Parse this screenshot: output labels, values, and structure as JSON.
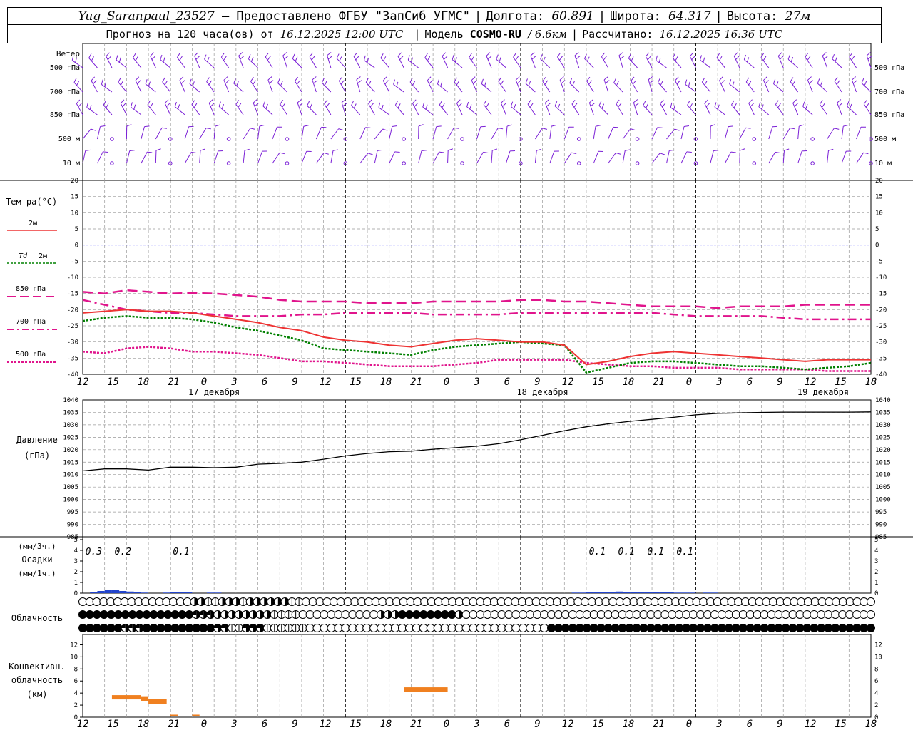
{
  "header": {
    "station": "Yug_Saranpaul_23527",
    "provider": "— Предоставлено ФГБУ \"ЗапСиб УГМС\"",
    "lon_label": "Долгота:",
    "lon_value": "60.891",
    "lat_label": "Широта:",
    "lat_value": "64.317",
    "alt_label": "Высота:",
    "alt_value": "27м",
    "forecast_label": "Прогноз на 120 часа(ов) от",
    "forecast_start": "16.12.2025 12:00 UTC",
    "model_label": "Модель",
    "model_name": "COSMO-RU",
    "model_res": "/ 6.6км",
    "calc_label": "Рассчитано:",
    "calc_time": "16.12.2025 16:36 UTC"
  },
  "labels": {
    "wind": "Ветер",
    "wind_levels": [
      "500 гПа",
      "700 гПа",
      "850 гПа",
      "500 м",
      "10 м"
    ],
    "temp_title": "Тем-ра(°C)",
    "temp_2m": "2м",
    "td_prefix": "Td",
    "td_2m": "2м",
    "t850": "850 гПа",
    "t700": "700 гПа",
    "t500": "500 гПа",
    "pressure": "Давление",
    "pressure_unit": "(гПа)",
    "precip_3h": "(мм/3ч.)",
    "precip": "Осадки",
    "precip_1h": "(мм/1ч.)",
    "cloud": "Облачность",
    "conv1": "Конвективн.",
    "conv2": "облачность",
    "conv3": "(км)"
  },
  "colors": {
    "wind": "#7a1fd6",
    "t2m": "#ee3333",
    "td2m": "#008000",
    "t850": "#e0148c",
    "t700": "#e0148c",
    "t500": "#e0148c",
    "zero_line": "#3a3aff",
    "pressure": "#000000",
    "precip": "#2244cc",
    "conv": "#f08020"
  },
  "chart_data": {
    "type": "line",
    "x_start": "16.12.2025 12:00 UTC",
    "x_step_hours": 1,
    "x_tick_labels": [
      "12",
      "15",
      "18",
      "21",
      "0",
      "3",
      "6",
      "9",
      "12",
      "15",
      "18",
      "21",
      "0",
      "3",
      "6",
      "9",
      "12",
      "15",
      "18",
      "21",
      "0",
      "3",
      "6",
      "9",
      "12",
      "15",
      "18"
    ],
    "day_labels": [
      "17 декабря",
      "18 декабря",
      "19 декабря"
    ],
    "temperature": {
      "ylim": [
        -40,
        20
      ],
      "yticks": [
        20,
        15,
        10,
        5,
        0,
        -5,
        -10,
        -15,
        -20,
        -25,
        -30,
        -35,
        -40
      ],
      "series": {
        "t2m": [
          [
            0,
            -21.0
          ],
          [
            3,
            -20.5
          ],
          [
            6,
            -20.0
          ],
          [
            9,
            -20.5
          ],
          [
            12,
            -20.5
          ],
          [
            15,
            -21.0
          ],
          [
            18,
            -22.0
          ],
          [
            21,
            -23.0
          ],
          [
            24,
            -24.0
          ],
          [
            27,
            -25.5
          ],
          [
            30,
            -26.5
          ],
          [
            33,
            -28.5
          ],
          [
            36,
            -29.5
          ],
          [
            39,
            -30.0
          ],
          [
            42,
            -31.0
          ],
          [
            45,
            -31.5
          ],
          [
            48,
            -30.5
          ],
          [
            51,
            -29.5
          ],
          [
            54,
            -29.0
          ],
          [
            57,
            -29.5
          ],
          [
            60,
            -30.0
          ],
          [
            63,
            -30.0
          ],
          [
            66,
            -31.0
          ],
          [
            69,
            -37.0
          ],
          [
            72,
            -36.0
          ],
          [
            75,
            -34.5
          ],
          [
            78,
            -33.5
          ],
          [
            81,
            -33.0
          ],
          [
            84,
            -33.5
          ],
          [
            87,
            -34.0
          ],
          [
            90,
            -34.5
          ],
          [
            93,
            -35.0
          ],
          [
            96,
            -35.5
          ],
          [
            99,
            -36.0
          ],
          [
            102,
            -35.5
          ],
          [
            105,
            -35.5
          ],
          [
            108,
            -35.5
          ]
        ],
        "td2m": [
          [
            0,
            -23.5
          ],
          [
            3,
            -22.5
          ],
          [
            6,
            -22.0
          ],
          [
            9,
            -22.5
          ],
          [
            12,
            -22.5
          ],
          [
            15,
            -23.0
          ],
          [
            18,
            -24.0
          ],
          [
            21,
            -25.5
          ],
          [
            24,
            -26.5
          ],
          [
            27,
            -28.0
          ],
          [
            30,
            -29.5
          ],
          [
            33,
            -32.0
          ],
          [
            36,
            -32.5
          ],
          [
            39,
            -33.0
          ],
          [
            42,
            -33.5
          ],
          [
            45,
            -34.0
          ],
          [
            48,
            -32.5
          ],
          [
            51,
            -31.5
          ],
          [
            54,
            -31.0
          ],
          [
            57,
            -30.5
          ],
          [
            60,
            -30.0
          ],
          [
            63,
            -30.5
          ],
          [
            66,
            -31.0
          ],
          [
            69,
            -39.5
          ],
          [
            72,
            -38.0
          ],
          [
            75,
            -36.5
          ],
          [
            78,
            -36.0
          ],
          [
            81,
            -36.0
          ],
          [
            84,
            -36.5
          ],
          [
            87,
            -37.0
          ],
          [
            90,
            -37.5
          ],
          [
            93,
            -37.5
          ],
          [
            96,
            -38.0
          ],
          [
            99,
            -38.5
          ],
          [
            102,
            -38.0
          ],
          [
            105,
            -37.5
          ],
          [
            108,
            -36.5
          ]
        ],
        "t850": [
          [
            0,
            -14.5
          ],
          [
            3,
            -15.0
          ],
          [
            6,
            -14.0
          ],
          [
            9,
            -14.5
          ],
          [
            12,
            -15.0
          ],
          [
            15,
            -14.8
          ],
          [
            18,
            -15.0
          ],
          [
            21,
            -15.5
          ],
          [
            24,
            -16.0
          ],
          [
            27,
            -17.0
          ],
          [
            30,
            -17.5
          ],
          [
            33,
            -17.5
          ],
          [
            36,
            -17.5
          ],
          [
            39,
            -18.0
          ],
          [
            42,
            -18.0
          ],
          [
            45,
            -18.0
          ],
          [
            48,
            -17.5
          ],
          [
            51,
            -17.5
          ],
          [
            54,
            -17.5
          ],
          [
            57,
            -17.5
          ],
          [
            60,
            -17.0
          ],
          [
            63,
            -17.0
          ],
          [
            66,
            -17.5
          ],
          [
            69,
            -17.5
          ],
          [
            72,
            -18.0
          ],
          [
            75,
            -18.5
          ],
          [
            78,
            -19.0
          ],
          [
            81,
            -19.0
          ],
          [
            84,
            -19.0
          ],
          [
            87,
            -19.5
          ],
          [
            90,
            -19.0
          ],
          [
            93,
            -19.0
          ],
          [
            96,
            -19.0
          ],
          [
            99,
            -18.5
          ],
          [
            102,
            -18.5
          ],
          [
            105,
            -18.5
          ],
          [
            108,
            -18.5
          ]
        ],
        "t700": [
          [
            0,
            -17.0
          ],
          [
            3,
            -18.5
          ],
          [
            6,
            -20.0
          ],
          [
            9,
            -20.5
          ],
          [
            12,
            -21.0
          ],
          [
            15,
            -21.0
          ],
          [
            18,
            -21.5
          ],
          [
            21,
            -22.0
          ],
          [
            24,
            -22.0
          ],
          [
            27,
            -22.0
          ],
          [
            30,
            -21.5
          ],
          [
            33,
            -21.5
          ],
          [
            36,
            -21.0
          ],
          [
            39,
            -21.0
          ],
          [
            42,
            -21.0
          ],
          [
            45,
            -21.0
          ],
          [
            48,
            -21.5
          ],
          [
            51,
            -21.5
          ],
          [
            54,
            -21.5
          ],
          [
            57,
            -21.5
          ],
          [
            60,
            -21.0
          ],
          [
            63,
            -21.0
          ],
          [
            66,
            -21.0
          ],
          [
            69,
            -21.0
          ],
          [
            72,
            -21.0
          ],
          [
            75,
            -21.0
          ],
          [
            78,
            -21.0
          ],
          [
            81,
            -21.5
          ],
          [
            84,
            -22.0
          ],
          [
            87,
            -22.0
          ],
          [
            90,
            -22.0
          ],
          [
            93,
            -22.0
          ],
          [
            96,
            -22.5
          ],
          [
            99,
            -23.0
          ],
          [
            102,
            -23.0
          ],
          [
            105,
            -23.0
          ],
          [
            108,
            -23.0
          ]
        ],
        "t500": [
          [
            0,
            -33.0
          ],
          [
            3,
            -33.5
          ],
          [
            6,
            -32.0
          ],
          [
            9,
            -31.5
          ],
          [
            12,
            -32.0
          ],
          [
            15,
            -33.0
          ],
          [
            18,
            -33.0
          ],
          [
            21,
            -33.5
          ],
          [
            24,
            -34.0
          ],
          [
            27,
            -35.0
          ],
          [
            30,
            -36.0
          ],
          [
            33,
            -36.0
          ],
          [
            36,
            -36.5
          ],
          [
            39,
            -37.0
          ],
          [
            42,
            -37.5
          ],
          [
            45,
            -37.5
          ],
          [
            48,
            -37.5
          ],
          [
            51,
            -37.0
          ],
          [
            54,
            -36.5
          ],
          [
            57,
            -35.5
          ],
          [
            60,
            -35.5
          ],
          [
            63,
            -35.5
          ],
          [
            66,
            -35.5
          ],
          [
            69,
            -36.5
          ],
          [
            72,
            -37.0
          ],
          [
            75,
            -37.5
          ],
          [
            78,
            -37.5
          ],
          [
            81,
            -38.0
          ],
          [
            84,
            -38.0
          ],
          [
            87,
            -38.0
          ],
          [
            90,
            -38.5
          ],
          [
            93,
            -38.5
          ],
          [
            96,
            -38.5
          ],
          [
            99,
            -38.5
          ],
          [
            102,
            -39.0
          ],
          [
            105,
            -39.0
          ],
          [
            108,
            -39.0
          ]
        ]
      }
    },
    "pressure": {
      "ylim": [
        985,
        1040
      ],
      "yticks": [
        1040,
        1035,
        1030,
        1025,
        1020,
        1015,
        1010,
        1005,
        1000,
        995,
        990,
        985
      ],
      "values": [
        [
          0,
          1011.5
        ],
        [
          3,
          1012.3
        ],
        [
          6,
          1012.3
        ],
        [
          9,
          1011.8
        ],
        [
          12,
          1013.0
        ],
        [
          15,
          1013.0
        ],
        [
          18,
          1012.8
        ],
        [
          21,
          1013.0
        ],
        [
          24,
          1014.2
        ],
        [
          27,
          1014.5
        ],
        [
          30,
          1015.0
        ],
        [
          33,
          1016.2
        ],
        [
          36,
          1017.5
        ],
        [
          39,
          1018.5
        ],
        [
          42,
          1019.2
        ],
        [
          45,
          1019.4
        ],
        [
          48,
          1020.2
        ],
        [
          51,
          1020.8
        ],
        [
          54,
          1021.4
        ],
        [
          57,
          1022.4
        ],
        [
          60,
          1024.0
        ],
        [
          63,
          1025.8
        ],
        [
          66,
          1027.6
        ],
        [
          69,
          1029.2
        ],
        [
          72,
          1030.4
        ],
        [
          75,
          1031.4
        ],
        [
          78,
          1032.2
        ],
        [
          81,
          1033.0
        ],
        [
          84,
          1034.0
        ],
        [
          87,
          1034.6
        ],
        [
          90,
          1034.8
        ],
        [
          93,
          1035.0
        ],
        [
          96,
          1035.1
        ],
        [
          99,
          1035.1
        ],
        [
          102,
          1035.1
        ],
        [
          105,
          1035.1
        ],
        [
          108,
          1035.2
        ]
      ]
    },
    "precipitation": {
      "ylim": [
        0,
        5
      ],
      "yticks": [
        5,
        4,
        3,
        2,
        1,
        0
      ],
      "labels_3h": [
        [
          1.5,
          "0.3"
        ],
        [
          5.5,
          "0.2"
        ],
        [
          13.5,
          "0.1"
        ],
        [
          70.5,
          "0.1"
        ],
        [
          74.5,
          "0.1"
        ],
        [
          78.5,
          "0.1"
        ],
        [
          82.5,
          "0.1"
        ]
      ],
      "bars": [
        [
          1,
          0.1
        ],
        [
          2,
          0.2
        ],
        [
          3,
          0.3
        ],
        [
          4,
          0.3
        ],
        [
          5,
          0.2
        ],
        [
          6,
          0.15
        ],
        [
          7,
          0.1
        ],
        [
          8,
          0.05
        ],
        [
          11,
          0.05
        ],
        [
          12,
          0.08
        ],
        [
          13,
          0.1
        ],
        [
          14,
          0.08
        ],
        [
          17,
          0.05
        ],
        [
          18,
          0.05
        ],
        [
          67,
          0.05
        ],
        [
          68,
          0.05
        ],
        [
          69,
          0.08
        ],
        [
          70,
          0.1
        ],
        [
          71,
          0.1
        ],
        [
          72,
          0.12
        ],
        [
          73,
          0.15
        ],
        [
          74,
          0.12
        ],
        [
          75,
          0.1
        ],
        [
          76,
          0.08
        ],
        [
          77,
          0.08
        ],
        [
          78,
          0.08
        ],
        [
          79,
          0.08
        ],
        [
          80,
          0.08
        ],
        [
          81,
          0.05
        ],
        [
          82,
          0.05
        ],
        [
          83,
          0.05
        ],
        [
          85,
          0.05
        ],
        [
          86,
          0.05
        ]
      ]
    },
    "cloud": {
      "rows": [
        "upper",
        "middle",
        "low"
      ],
      "upper": "ooooooooooooooooeelleeeleeeeeelloooooooooooooooooooooooooooooooooooooooooooooooooooooooooooooooooooooooooooooooooo",
      "middle": "ffffffffffffffffhhheeeeeeeelllloooooooooooeeeffffffffeoooooooooooooooooooooooooooooooooooooooooooooooooooooooooo",
      "low": "ffffffhhhffffffffffhhllhhhllllllooooooooooooooooooooooooooooooooooffffffffffffffffffffffffffffffffffffffffffffff"
    },
    "convective_cloud": {
      "ylim": [
        0,
        13
      ],
      "yticks": [
        12,
        10,
        8,
        6,
        4,
        2,
        0
      ],
      "segments": [
        [
          4,
          8,
          3.3
        ],
        [
          8,
          9,
          3.0
        ],
        [
          9,
          11.5,
          2.6
        ],
        [
          12,
          13,
          0.3
        ],
        [
          15,
          16,
          0.3
        ],
        [
          44,
          50,
          4.6
        ]
      ]
    },
    "wind_levels": [
      "500 гПа",
      "700 гПа",
      "850 гПа",
      "500 м",
      "10 м"
    ]
  }
}
